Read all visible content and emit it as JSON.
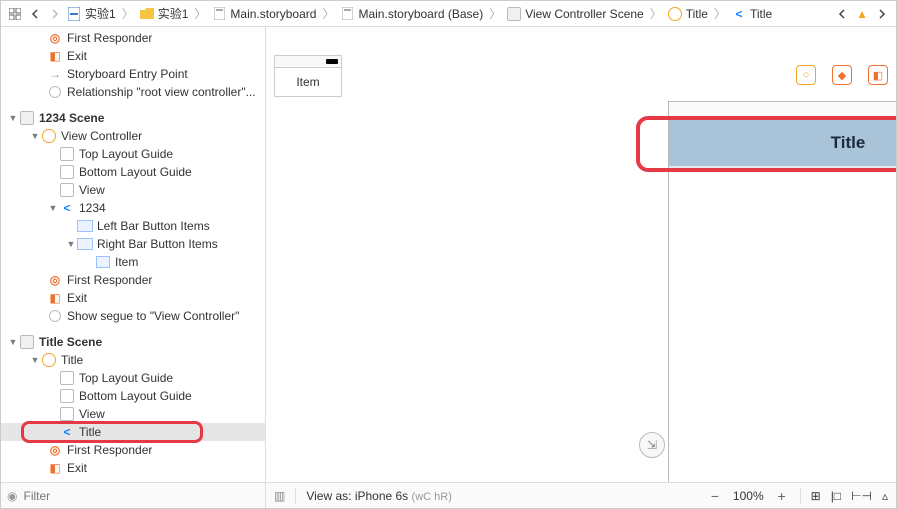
{
  "breadcrumb": {
    "items": [
      {
        "label": "实验1",
        "kind": "project"
      },
      {
        "label": "实验1",
        "kind": "folder"
      },
      {
        "label": "Main.storyboard",
        "kind": "file"
      },
      {
        "label": "Main.storyboard (Base)",
        "kind": "file"
      },
      {
        "label": "View Controller Scene",
        "kind": "scene"
      },
      {
        "label": "Title",
        "kind": "object"
      },
      {
        "label": "Title",
        "kind": "navitem"
      }
    ]
  },
  "outline": {
    "top_truncated_label": "First Responder",
    "exit_label": "Exit",
    "entry_label": "Storyboard Entry Point",
    "relationship_label": "Relationship \"root view controller\"...",
    "scene1234": "1234 Scene",
    "vc": "View Controller",
    "top_guide": "Top Layout Guide",
    "bottom_guide": "Bottom Layout Guide",
    "view": "View",
    "nav1234": "1234",
    "left_bar": "Left Bar Button Items",
    "right_bar": "Right Bar Button Items",
    "item": "Item",
    "first_responder": "First Responder",
    "segue": "Show segue to \"View Controller\"",
    "title_scene": "Title Scene",
    "title": "Title",
    "nav_title": "Title"
  },
  "canvas": {
    "mini_item": "Item",
    "navbar_title": "Title",
    "view_as_prefix": "View as: ",
    "view_as_device": "iPhone 6s",
    "view_as_traits": "(wC hR)",
    "zoom": "100%"
  },
  "filter": {
    "placeholder": "Filter"
  }
}
